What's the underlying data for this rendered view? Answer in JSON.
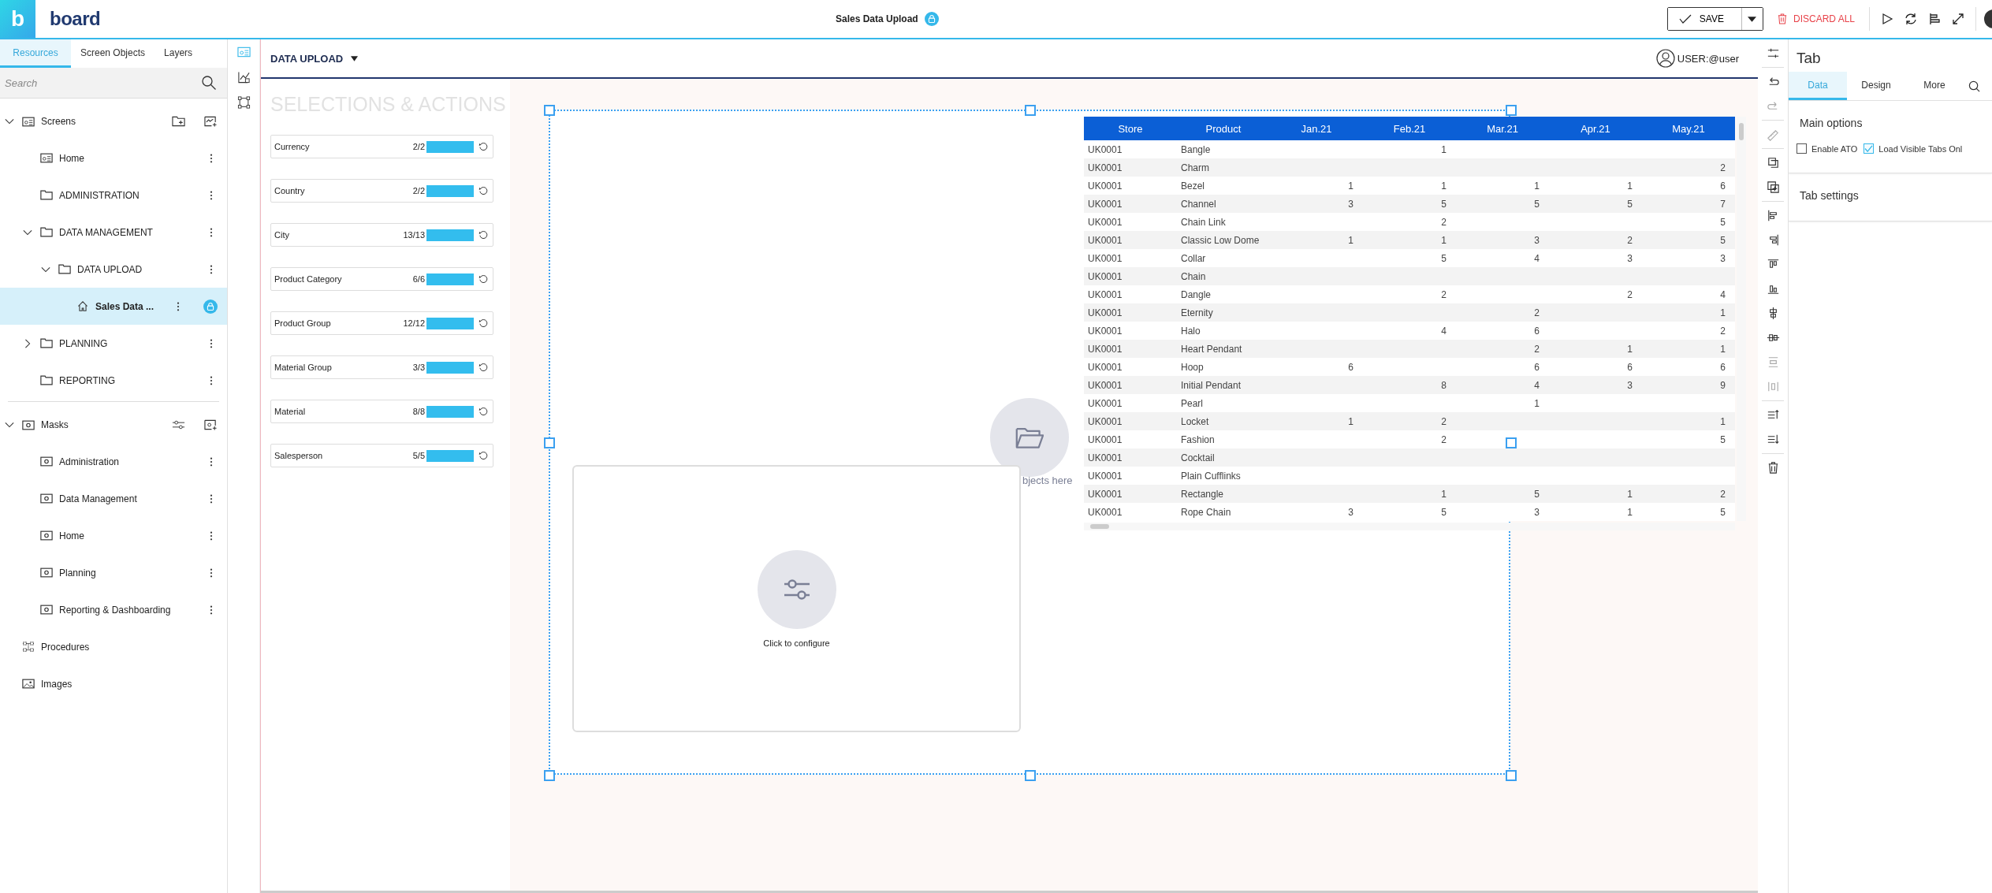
{
  "app": {
    "logo_mark": "b",
    "logo": "board",
    "title": "Sales Data Upload",
    "locked": true,
    "actions": [
      {
        "kind": "save",
        "label": "SAVE"
      },
      {
        "kind": "discard",
        "label": "DISCARD ALL"
      }
    ]
  },
  "sidebar": {
    "tabs": [
      {
        "label": "Resources",
        "selected": true
      },
      {
        "label": "Screen Objects",
        "selected": false
      },
      {
        "label": "Layers",
        "selected": false
      }
    ],
    "search": {
      "placeholder": "Search"
    },
    "tree": [
      {
        "kind": "screens",
        "label": "Screens",
        "expanded": true,
        "selected": false,
        "children": [
          {
            "kind": "screen",
            "label": "Home",
            "selected": false
          },
          {
            "kind": "folder",
            "label": "ADMINISTRATION",
            "selected": false
          },
          {
            "kind": "folder",
            "label": "DATA MANAGEMENT",
            "expanded": true,
            "selected": false,
            "children": [
              {
                "kind": "folder",
                "label": "DATA UPLOAD",
                "expanded": true,
                "selected": false,
                "children": [
                  {
                    "kind": "home",
                    "label": "Sales Data ...",
                    "selected": true,
                    "locked": true
                  }
                ]
              }
            ]
          },
          {
            "kind": "folder",
            "label": "PLANNING",
            "expanded": false,
            "selected": false
          },
          {
            "kind": "folder",
            "label": "REPORTING",
            "selected": false
          }
        ]
      },
      {
        "kind": "masks",
        "label": "Masks",
        "expanded": true,
        "selected": false,
        "children": [
          {
            "kind": "mask",
            "label": "Administration",
            "selected": false
          },
          {
            "kind": "mask",
            "label": "Data Management",
            "selected": false
          },
          {
            "kind": "mask",
            "label": "Home",
            "selected": false
          },
          {
            "kind": "mask",
            "label": "Planning",
            "selected": false
          },
          {
            "kind": "mask",
            "label": "Reporting & Dashboarding",
            "selected": false
          }
        ]
      },
      {
        "kind": "procedures",
        "label": "Procedures",
        "selected": false
      },
      {
        "kind": "images",
        "label": "Images",
        "selected": false
      }
    ]
  },
  "canvas": {
    "breadcrumb": "DATA UPLOAD",
    "user": "USER:@user",
    "selections": {
      "title": "SELECTIONS & ACTIONS",
      "items": [
        {
          "label": "Currency",
          "count": "2/2",
          "level": 1
        },
        {
          "label": "Country",
          "count": "2/2",
          "level": 1
        },
        {
          "label": "City",
          "count": "13/13",
          "level": 1
        },
        {
          "label": "Product Category",
          "count": "6/6",
          "level": 1
        },
        {
          "label": "Product Group",
          "count": "12/12",
          "level": 1
        },
        {
          "label": "Material Group",
          "count": "3/3",
          "level": 1
        },
        {
          "label": "Material",
          "count": "8/8",
          "level": 1
        },
        {
          "label": "Salesperson",
          "count": "5/5",
          "level": 1
        }
      ]
    },
    "config_card": {
      "label": "Click to configure"
    },
    "drop_hint": "bjects here",
    "table": {
      "columns": [
        "Store",
        "Product",
        "Jan.21",
        "Feb.21",
        "Mar.21",
        "Apr.21",
        "May.21"
      ],
      "rows": [
        [
          "UK0001",
          "Bangle",
          "",
          "1",
          "",
          "",
          ""
        ],
        [
          "UK0001",
          "Charm",
          "",
          "",
          "",
          "",
          "2"
        ],
        [
          "UK0001",
          "Bezel",
          "1",
          "1",
          "1",
          "1",
          "6"
        ],
        [
          "UK0001",
          "Channel",
          "3",
          "5",
          "5",
          "5",
          "7"
        ],
        [
          "UK0001",
          "Chain Link",
          "",
          "2",
          "",
          "",
          "5"
        ],
        [
          "UK0001",
          "Classic Low Dome",
          "1",
          "1",
          "3",
          "2",
          "5"
        ],
        [
          "UK0001",
          "Collar",
          "",
          "5",
          "4",
          "3",
          "3"
        ],
        [
          "UK0001",
          "Chain",
          "",
          "",
          "",
          "",
          ""
        ],
        [
          "UK0001",
          "Dangle",
          "",
          "2",
          "",
          "2",
          "4"
        ],
        [
          "UK0001",
          "Eternity",
          "",
          "",
          "2",
          "",
          "1"
        ],
        [
          "UK0001",
          "Halo",
          "",
          "4",
          "6",
          "",
          "2"
        ],
        [
          "UK0001",
          "Heart Pendant",
          "",
          "",
          "2",
          "1",
          "1"
        ],
        [
          "UK0001",
          "Hoop",
          "6",
          "",
          "6",
          "6",
          "6"
        ],
        [
          "UK0001",
          "Initial Pendant",
          "",
          "8",
          "4",
          "3",
          "9"
        ],
        [
          "UK0001",
          "Pearl",
          "",
          "",
          "1",
          "",
          ""
        ],
        [
          "UK0001",
          "Locket",
          "1",
          "2",
          "",
          "",
          "1"
        ],
        [
          "UK0001",
          "Fashion",
          "",
          "2",
          "",
          "",
          "5"
        ],
        [
          "UK0001",
          "Cocktail",
          "",
          "",
          "",
          "",
          ""
        ],
        [
          "UK0001",
          "Plain Cufflinks",
          "",
          "",
          "",
          "",
          ""
        ],
        [
          "UK0001",
          "Rectangle",
          "",
          "1",
          "5",
          "1",
          "2"
        ],
        [
          "UK0001",
          "Rope Chain",
          "3",
          "5",
          "3",
          "1",
          "5"
        ]
      ]
    }
  },
  "properties": {
    "title": "Tab",
    "tabs": [
      {
        "label": "Data",
        "selected": true
      },
      {
        "label": "Design",
        "selected": false
      },
      {
        "label": "More",
        "selected": false
      }
    ],
    "sections": [
      {
        "title": "Main options",
        "options": [
          {
            "label": "Enable ATO",
            "checked": false
          },
          {
            "label": "Load Visible Tabs Onl",
            "checked": true
          }
        ]
      },
      {
        "title": "Tab settings"
      }
    ]
  }
}
